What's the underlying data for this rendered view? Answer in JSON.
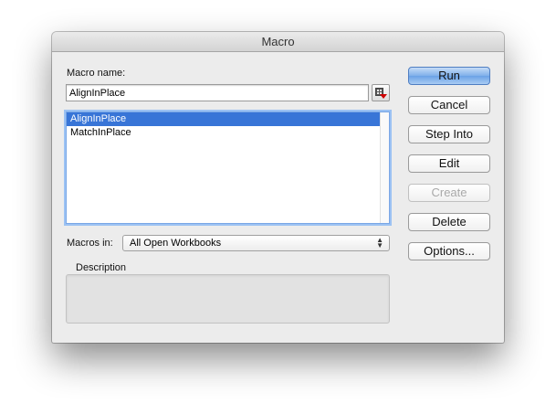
{
  "window": {
    "title": "Macro"
  },
  "macro_name": {
    "label": "Macro name:",
    "value": "AlignInPlace",
    "reference_icon": "range-select-icon"
  },
  "macro_list": {
    "items": [
      {
        "label": "AlignInPlace",
        "selected": true
      },
      {
        "label": "MatchInPlace",
        "selected": false
      }
    ]
  },
  "macros_in": {
    "label": "Macros in:",
    "selected": "All Open Workbooks"
  },
  "description": {
    "label": "Description",
    "text": ""
  },
  "buttons": {
    "run": "Run",
    "cancel": "Cancel",
    "step_into": "Step Into",
    "edit": "Edit",
    "create": "Create",
    "delete": "Delete",
    "options": "Options..."
  },
  "colors": {
    "selection": "#3875d7",
    "default_button": "#6ba2e6",
    "focus_ring": "#9cc2f3"
  }
}
